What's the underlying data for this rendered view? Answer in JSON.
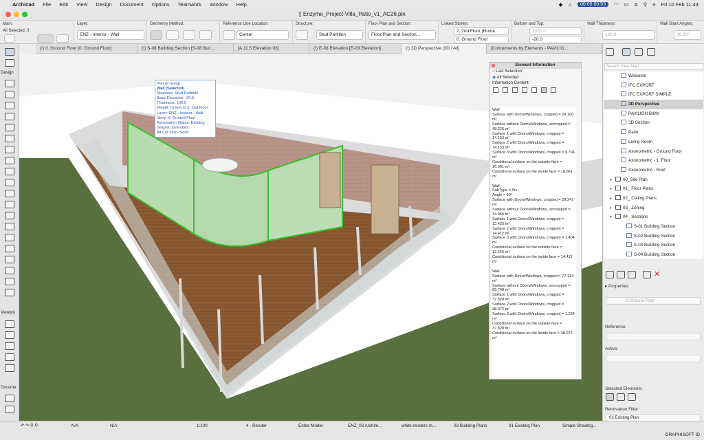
{
  "menubar": {
    "app": "Archicad",
    "items": [
      "File",
      "Edit",
      "View",
      "Design",
      "Document",
      "Options",
      "Teamwork",
      "Window",
      "Help"
    ],
    "timer": "00:05 00:53",
    "clock": "Fri 10 Feb 11:44"
  },
  "window": {
    "title": "Enzyme_Project-Villa_Patio_v1_AC26.pln"
  },
  "infobox": {
    "main_label": "Main:",
    "selection": "All Selected: 3",
    "layer_label": "Layer:",
    "layer_value": "ENZ - Interior - Wall",
    "geometry_label": "Geometry Method:",
    "refline_label": "Reference Line Location:",
    "refline_value": "Center",
    "structure_label": "Structure:",
    "structure_value": "Stud Partition",
    "floorplan_label": "Floor Plan and Section:",
    "floorplan_value": "Floor Plan and Section...",
    "linked_label": "Linked Stories:",
    "linked_top": "2. 2nd Floor (Home...",
    "linked_bottom": "0. Ground Floor",
    "bt_label": "Bottom and Top:",
    "bt_top": "7020.0",
    "bt_bottom": "-20.0",
    "thick_label": "Wall Thickness:",
    "thick_value": "100.0",
    "slant_label": "Wall Slant Angles:",
    "slant_value": "90.00°"
  },
  "tabs": [
    "(!) 0. Ground Floor [0. Ground Floor]",
    "(!) S-08 Building Section [S-08 Buil...",
    "[A.11.5 Elevation 03]",
    "(!) E-03 Elevation [E-03 Elevation]",
    "(!) 3D Perspective [3D / All]",
    "[Components by Elements - PAVILIO..."
  ],
  "toolbox": {
    "sections": [
      "Design",
      "Viewpoi",
      "Docume"
    ]
  },
  "tooltip": {
    "lines": [
      "Part of Group:",
      "Wall (Selected)",
      "Structure: Stud Partition",
      "Base Elevation: -20.0",
      "Thickness: 100.0",
      "Height: Linked to 2. 2nd Floor",
      "Layer: ENZ - Interior - Wall",
      "Story: 0. Ground Floor",
      "Renovation Status: Existing",
      "Graphic Overrides:",
      "All Cut Fills - Solid"
    ]
  },
  "eip": {
    "title": "Element Information",
    "last_selection": "Last Selection",
    "all_selected": "All Selected",
    "info_content": "Information Content:",
    "text": "Wall\nSurface with Doors/Windows, cropped = 29.100 m²\nSurface without Doors/Windows, uncropped = 48.226 m²\nSurface 1 with Doors/Windows, cropped = 14.153 m²\nSurface 2 with Doors/Windows, cropped = 14.153 m²\nSurface 3 with Doors/Windows, cropped = 0.794 m²\nConditional surface on the outside face = 16.061 m²\nConditional surface on the inside face = 16.061 m²\n\nWall\nSubType = Arc\nAngle = 90°\nSurface with Doors/Windows, cropped = 29.241 m²\nSurface without Doors/Windows, uncropped = 34.956 m²\nSurface 1 with Doors/Windows, cropped = 13.425 m²\nSurface 2 with Doors/Windows, cropped = 14.412 m²\nSurface 3 with Doors/Windows, cropped = 1.404 m²\nConditional surface on the outside face = 13.425 m²\nConditional surface on the inside face = 14.412 m²\n\nWall\nSurface with Doors/Windows, cropped = 77.134 m²\nSurface without Doors/Windows, uncropped = 89.748 m²\nSurface 1 with Doors/Windows, cropped = 37.828 m²\nSurface 2 with Doors/Windows, cropped = 38.072 m²\nSurface 3 with Doors/Windows, cropped = 1.234 m²\nConditional surface on the outside face = 37.828 m²\nConditional surface on the inside face = 38.072 m²"
  },
  "navigator": {
    "search_placeholder": "Search View Map",
    "items": [
      {
        "label": "Welcome",
        "type": "view",
        "indent": 1
      },
      {
        "label": "IFC EXPORT",
        "type": "view",
        "indent": 1
      },
      {
        "label": "IFC EXPORT SIMPLE",
        "type": "view",
        "indent": 1
      },
      {
        "label": "3D Perspective",
        "type": "view",
        "indent": 1,
        "selected": true
      },
      {
        "label": "PAVILION BIMX",
        "type": "view",
        "indent": 1
      },
      {
        "label": "3D Section",
        "type": "view",
        "indent": 1
      },
      {
        "label": "Patio",
        "type": "view",
        "indent": 1
      },
      {
        "label": "Living Room",
        "type": "view",
        "indent": 1
      },
      {
        "label": "Axonometric - Ground Floor",
        "type": "view",
        "indent": 1
      },
      {
        "label": "Axonometric - 1. Floor",
        "type": "view",
        "indent": 1
      },
      {
        "label": "Axonometric - Roof",
        "type": "view",
        "indent": 1
      },
      {
        "label": "00_Site Plan",
        "type": "folder",
        "indent": 0
      },
      {
        "label": "01_ Floor Plans",
        "type": "folder",
        "indent": 0
      },
      {
        "label": "02_ Ceiling Plans",
        "type": "folder",
        "indent": 0
      },
      {
        "label": "03_ Zoning",
        "type": "folder",
        "indent": 0
      },
      {
        "label": "04_ Sections",
        "type": "folder",
        "indent": 0,
        "open": true
      },
      {
        "label": "S-01 Building Section",
        "type": "view",
        "indent": 2
      },
      {
        "label": "S-02 Building Section",
        "type": "view",
        "indent": 2
      },
      {
        "label": "S-03 Building Section",
        "type": "view",
        "indent": 2
      },
      {
        "label": "S-04 Building Section",
        "type": "view",
        "indent": 2
      }
    ],
    "properties_label": "Properties",
    "story_value": "0. Ground Floor",
    "reference_label": "Reference:",
    "active_label": "Active:",
    "selected_elements_label": "Selected Elements:",
    "renovation_label": "Renovation Filter:",
    "renovation_value": "01 Existing Plan"
  },
  "statusbar": {
    "na1": "N/A",
    "na2": "N/A",
    "scale": "1:100",
    "render": "4 - Render",
    "model": "Entire Model",
    "layer_combo": "ENZ_03 Archite...",
    "pen_set": "white renders m...",
    "mvo": "03 Building Plans",
    "renovation": "01 Existing Plan",
    "shading": "Simple Shading..."
  },
  "bottombar": {
    "brand": "GRAPHISOFT ID"
  }
}
